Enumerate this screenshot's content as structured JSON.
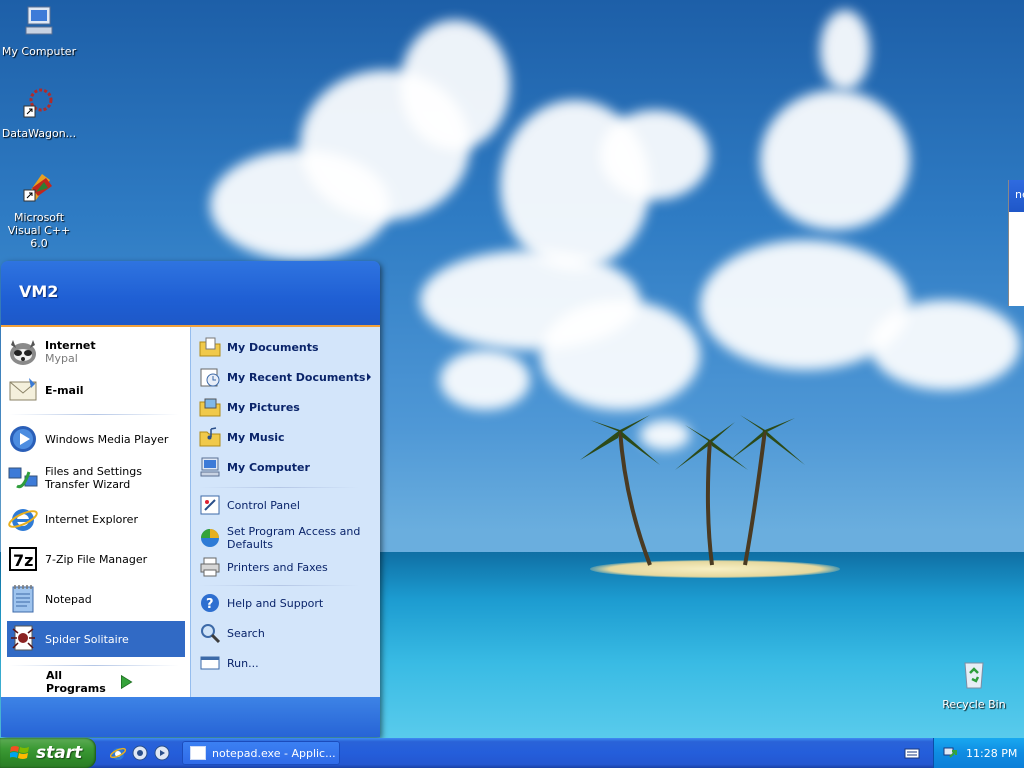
{
  "desktop": {
    "icons": [
      {
        "label": "My Computer"
      },
      {
        "label": "DataWagon..."
      },
      {
        "label": "Microsoft Visual C++ 6.0"
      },
      {
        "label": "Recycle Bin"
      }
    ],
    "partial_window_title": "ne"
  },
  "start_menu": {
    "user": "VM2",
    "pinned": [
      {
        "title": "Internet",
        "subtitle": "Mypal",
        "icon": "raccoon-browser-icon"
      },
      {
        "title": "E-mail",
        "icon": "email-icon"
      }
    ],
    "recent": [
      {
        "label": "Windows Media Player",
        "icon": "media-player-icon"
      },
      {
        "label": "Files and Settings Transfer Wizard",
        "icon": "transfer-wizard-icon"
      },
      {
        "label": "Internet Explorer",
        "icon": "ie-icon"
      },
      {
        "label": "7-Zip File Manager",
        "icon": "7zip-icon"
      },
      {
        "label": "Notepad",
        "icon": "notepad-icon"
      },
      {
        "label": "Spider Solitaire",
        "icon": "spider-solitaire-icon",
        "selected": true
      }
    ],
    "all_programs": "All Programs",
    "right": [
      {
        "label": "My Documents",
        "bold": true,
        "icon": "folder-documents-icon"
      },
      {
        "label": "My Recent Documents",
        "bold": true,
        "icon": "recent-documents-icon",
        "submenu": true
      },
      {
        "label": "My Pictures",
        "bold": true,
        "icon": "folder-pictures-icon"
      },
      {
        "label": "My Music",
        "bold": true,
        "icon": "folder-music-icon"
      },
      {
        "label": "My Computer",
        "bold": true,
        "icon": "computer-icon"
      },
      {
        "label": "Control Panel",
        "icon": "control-panel-icon"
      },
      {
        "label": "Set Program Access and Defaults",
        "icon": "program-access-icon"
      },
      {
        "label": "Printers and Faxes",
        "icon": "printer-icon"
      },
      {
        "label": "Help and Support",
        "icon": "help-icon"
      },
      {
        "label": "Search",
        "icon": "search-icon"
      },
      {
        "label": "Run...",
        "icon": "run-icon"
      }
    ]
  },
  "taskbar": {
    "start_label": "start",
    "quick_launch": [
      "ie-icon",
      "mypal-icon",
      "media-player-icon"
    ],
    "window_button": "notepad.exe - Applic...",
    "clock": "11:28 PM"
  },
  "colors": {
    "taskbar_blue": "#245edb",
    "start_green": "#3c9a35",
    "menu_right_bg": "#d3e5fa",
    "selection": "#316ac5",
    "header_orange_line": "#f2a13b"
  }
}
